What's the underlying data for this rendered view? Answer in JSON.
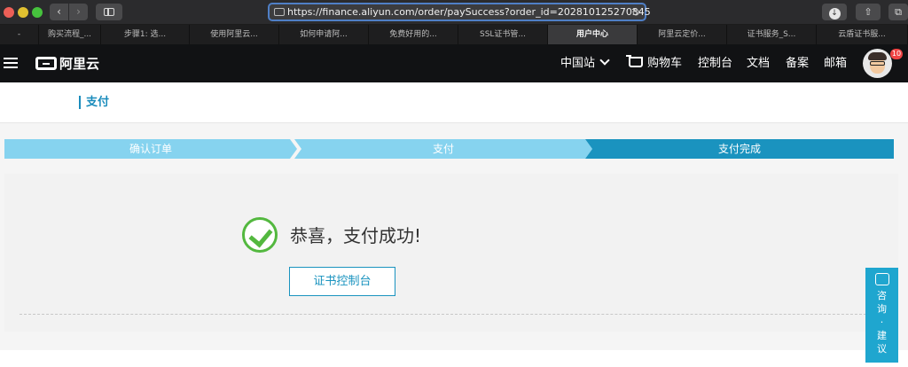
{
  "browser": {
    "url": "https://finance.aliyun.com/order/paySuccess?order_id=202810125270345",
    "tabs": [
      {
        "label": "-"
      },
      {
        "label": "购买流程_..."
      },
      {
        "label": "步骤1: 选..."
      },
      {
        "label": "使用阿里云..."
      },
      {
        "label": "如何申请阿..."
      },
      {
        "label": "免费好用的..."
      },
      {
        "label": "SSL证书管..."
      },
      {
        "label": "用户中心"
      },
      {
        "label": "阿里云定价..."
      },
      {
        "label": "证书服务_S..."
      },
      {
        "label": "云盾证书服..."
      }
    ]
  },
  "header": {
    "logo_text": "阿里云",
    "region": "中国站",
    "cart": "购物车",
    "console": "控制台",
    "docs": "文档",
    "filing": "备案",
    "mail": "邮箱",
    "badge_count": "10"
  },
  "page": {
    "title": "支付",
    "steps": [
      {
        "label": "确认订单"
      },
      {
        "label": "支付"
      },
      {
        "label": "支付完成"
      }
    ],
    "success_message": "恭喜，支付成功!",
    "console_button": "证书控制台"
  },
  "side_float": {
    "label": "咨询·建议"
  },
  "colors": {
    "accent": "#1a93bf",
    "step_inactive": "#86d3ef",
    "success": "#53b83f",
    "header_bg": "#111214"
  }
}
